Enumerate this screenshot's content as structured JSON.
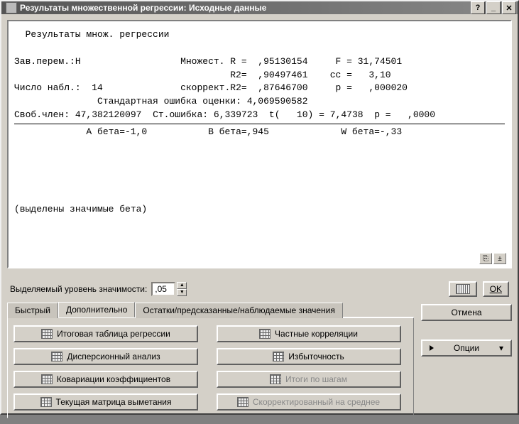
{
  "window": {
    "title": "Результаты множественной регрессии: Исходные данные"
  },
  "results": {
    "heading": "Результаты множ. регрессии",
    "dep_label": "Зав.перем.:Н",
    "mult_r_label": "Множест. R = ",
    "mult_r": ",95130154",
    "f_label": "F = ",
    "f": "31,74501",
    "r2_label": "R2= ",
    "r2": ",90497461",
    "cc_label": "сс = ",
    "cc": "3,10",
    "nobs_label": "Число набл.:",
    "nobs": "14",
    "adj_r2_label": "скоррект.R2= ",
    "adj_r2": ",87646700",
    "p_label": "p = ",
    "p": ",000020",
    "stderr_label": "Стандартная ошибка оценки:",
    "stderr": "4,069590582",
    "intercept_label": "Своб.член:",
    "intercept": "47,382120097",
    "se_intercept_label": "Ст.ошибка:",
    "se_intercept": "6,339723",
    "t_label": "t(",
    "t_df": "10",
    "t_label2": ") = ",
    "t": "7,4738",
    "p2_label": "p = ",
    "p2": ",0000",
    "beta_a": "A бета=-1,0",
    "beta_b": "B бета=,945",
    "beta_w": "W бета=-,33",
    "footnote": "(выделены значимые бета)"
  },
  "controls": {
    "alpha_label": "Выделяемый уровень значимости:",
    "alpha_value": ",05",
    "ok": "OK",
    "cancel": "Отмена",
    "options": "Опции"
  },
  "tabs": {
    "t1": "Быстрый",
    "t2": "Дополнительно",
    "t3": "Остатки/предсказанные/наблюдаемые значения"
  },
  "buttons": {
    "b1": "Итоговая таблица регрессии",
    "b2": "Частные корреляции",
    "b3": "Дисперсионный анализ",
    "b4": "Избыточность",
    "b5": "Ковариации коэффициентов",
    "b6": "Итоги по шагам",
    "b7": "Текущая матрица выметания",
    "b8": "Скорректированный на среднее"
  }
}
